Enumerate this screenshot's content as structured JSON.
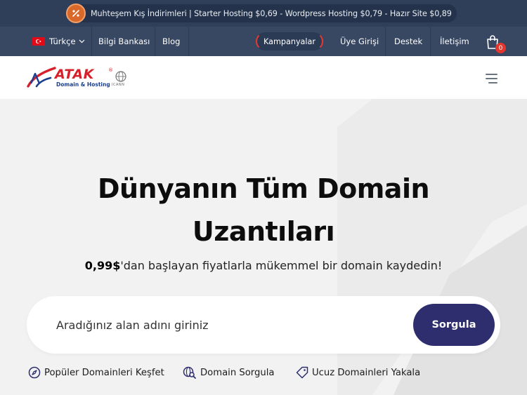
{
  "promo": {
    "text": "Muhteşem Kış İndirimleri | Starter Hosting $0,69 - Wordpress Hosting $0,79 - Hazır Site $0,89",
    "icon": "badge-percent-icon"
  },
  "nav": {
    "language": "Türkçe",
    "knowledge_base": "Bilgi Bankası",
    "blog": "Blog",
    "campaigns": "Kampanyalar",
    "member_login": "Üye Girişi",
    "support": "Destek",
    "contact": "İletişim",
    "cart_count": "0"
  },
  "logo": {
    "word": "ATAK",
    "sub": "Domain & Hosting",
    "reg": "®",
    "icann": "ICANN"
  },
  "hero": {
    "title_line1": "Dünyanın Tüm Domain",
    "title_line2": "Uzantıları",
    "price": "0,99$",
    "subtitle_rest": "'dan başlayan fiyatlarla mükemmel bir domain kaydedin!"
  },
  "search": {
    "placeholder": "Aradığınız alan adını giriniz",
    "button_label": "Sorgula"
  },
  "quick_links": [
    {
      "label": "Popüler Domainleri Keşfet",
      "icon": "compass-icon"
    },
    {
      "label": "Domain Sorgula",
      "icon": "globe-search-icon"
    },
    {
      "label": "Ucuz Domainleri Yakala",
      "icon": "tag-icon"
    }
  ],
  "colors": {
    "topbar": "#2f3f59",
    "navbar": "#384762",
    "accent_red": "#e43a2f",
    "button": "#2e2e6e",
    "hero_bg": "#f2f2f2"
  }
}
